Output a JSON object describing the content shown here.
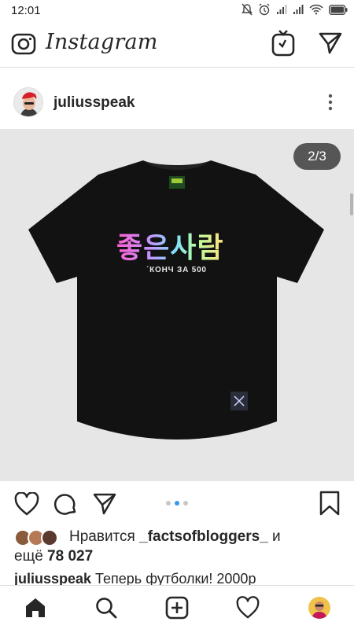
{
  "status_bar": {
    "time": "12:01",
    "icons": [
      "mute-icon",
      "alarm-icon",
      "signal-icon",
      "signal-icon",
      "wifi-icon",
      "battery-icon"
    ]
  },
  "app_header": {
    "title": "Instagram",
    "left_icon": "camera-icon",
    "right_icons": [
      "igtv-icon",
      "direct-message-icon"
    ]
  },
  "post": {
    "username": "juliusspeak",
    "more_icon": "more-vertical-icon",
    "image_counter": "2/3",
    "image": {
      "print_text": "좋은사람",
      "print_subtext": "ˊКОНЧ ЗА 500"
    },
    "carousel": {
      "total": 3,
      "active": 2
    },
    "actions": [
      "heart-icon",
      "comment-icon",
      "share-icon",
      "bookmark-icon"
    ],
    "likes": {
      "prefix": "Нравится ",
      "user": "_factsofbloggers_",
      "connector": " и",
      "line2_prefix": "ещё ",
      "count": "78 027"
    },
    "caption": {
      "user": "juliusspeak",
      "text": " Теперь футболки! 2000р"
    }
  },
  "bottom_nav": {
    "items": [
      "home-icon",
      "search-icon",
      "new-post-icon",
      "activity-icon",
      "profile-avatar"
    ]
  },
  "colors": {
    "accent": "#3897f0",
    "text": "#262626",
    "border": "#dbdbdb",
    "media_background": "#e6e6e6"
  }
}
